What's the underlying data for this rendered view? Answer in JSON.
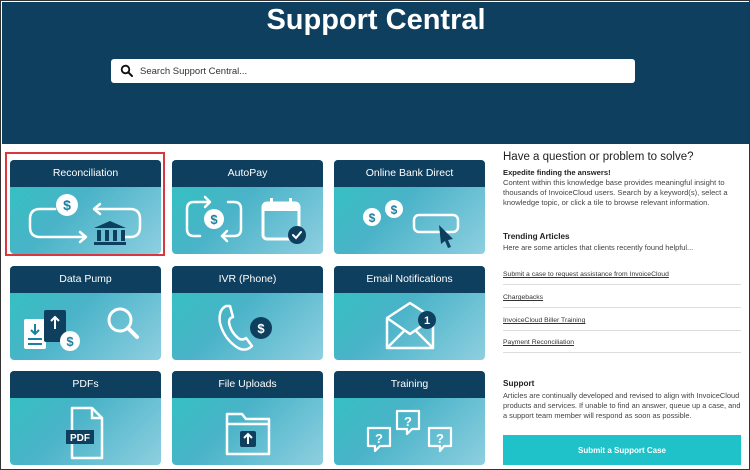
{
  "header": {
    "title": "Support Central",
    "search_placeholder": "Search Support Central..."
  },
  "tiles": [
    {
      "label": "Reconciliation",
      "icon": "reconciliation-icon",
      "selected": true
    },
    {
      "label": "AutoPay",
      "icon": "autopay-calendar-icon"
    },
    {
      "label": "Online Bank Direct",
      "icon": "bank-direct-cursor-icon"
    },
    {
      "label": "Data Pump",
      "icon": "data-pump-icon"
    },
    {
      "label": "IVR (Phone)",
      "icon": "phone-dollar-icon"
    },
    {
      "label": "Email Notifications",
      "icon": "envelope-notification-icon",
      "badge": "1"
    },
    {
      "label": "PDFs",
      "icon": "pdf-file-icon",
      "file_label": "PDF"
    },
    {
      "label": "File Uploads",
      "icon": "folder-upload-icon"
    },
    {
      "label": "Training",
      "icon": "question-bubbles-icon"
    }
  ],
  "sidebar": {
    "heading": "Have a question or problem to solve?",
    "subheading": "Expedite finding the answers!",
    "intro": "Content within this knowledge base provides meaningful insight to thousands of InvoiceCloud users.  Search by a keyword(s), select a knowledge topic, or click a tile to browse relevant information.",
    "trending_heading": "Trending Articles",
    "trending_intro": "Here are some articles that clients recently found helpful...",
    "trending_links": [
      "Submit a case to request assistance from InvoiceCloud",
      "Chargebacks",
      "InvoiceCloud Biller Training",
      "Payment Reconciliation"
    ],
    "support_heading": "Support",
    "support_text": "Articles are continually developed and revised to align with InvoiceCloud products and services.  If unable to find an answer, queue up a case, and a support team member will respond as soon as possible.",
    "support_button": "Submit a Support Case"
  },
  "colors": {
    "navy": "#0e3f5e",
    "teal": "#2ec4c0",
    "button": "#1fc2c8",
    "highlight": "#d9363e"
  }
}
